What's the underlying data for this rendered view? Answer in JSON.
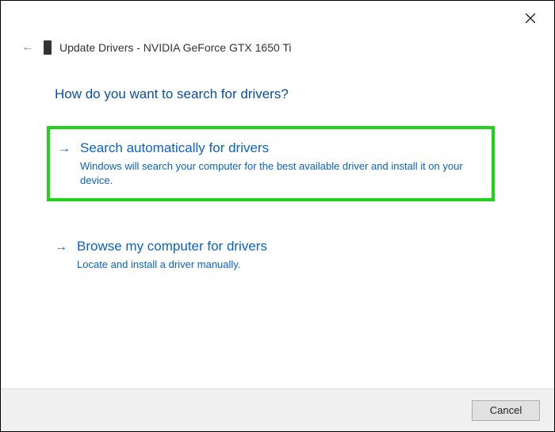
{
  "window": {
    "title": "Update Drivers - NVIDIA GeForce GTX 1650 Ti"
  },
  "heading": "How do you want to search for drivers?",
  "options": {
    "auto": {
      "title": "Search automatically for drivers",
      "desc": "Windows will search your computer for the best available driver and install it on your device."
    },
    "browse": {
      "title": "Browse my computer for drivers",
      "desc": "Locate and install a driver manually."
    }
  },
  "footer": {
    "cancel_label": "Cancel"
  }
}
